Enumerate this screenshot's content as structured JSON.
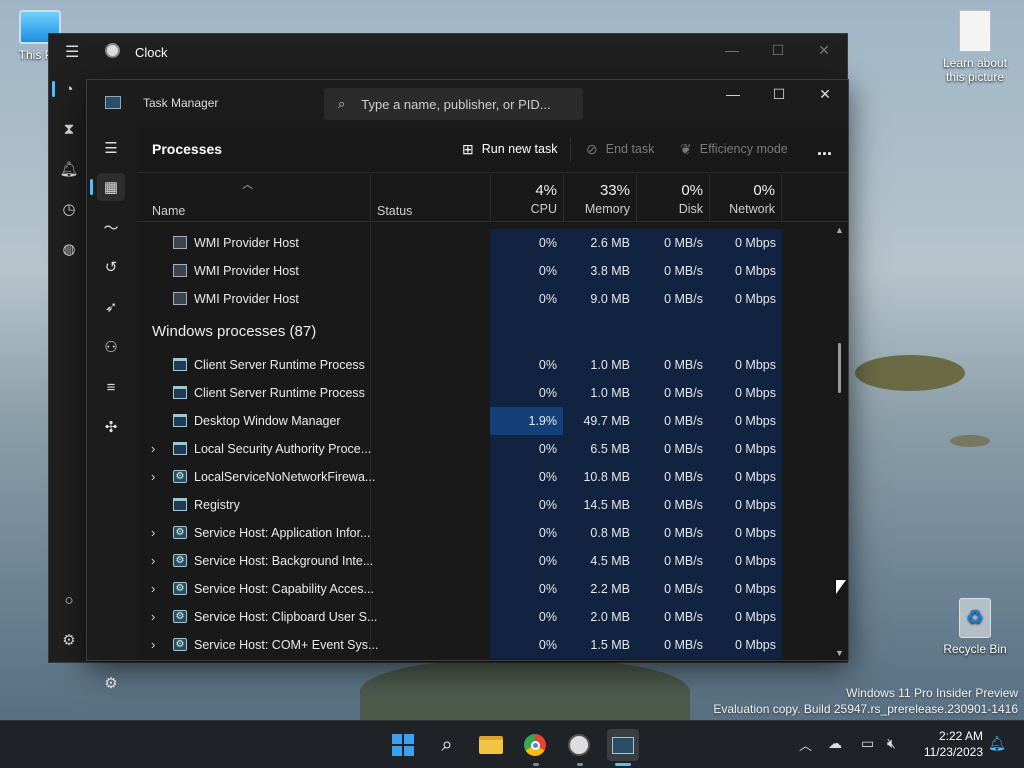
{
  "desktop": {
    "icons": [
      {
        "label": "This PC"
      },
      {
        "label": "Learn about this picture"
      },
      {
        "label": "Recycle Bin"
      }
    ],
    "watermark": {
      "line1": "Windows 11 Pro Insider Preview",
      "line2": "Evaluation copy. Build 25947.rs_prerelease.230901-1416"
    }
  },
  "clock_window": {
    "title": "Clock"
  },
  "task_manager": {
    "title": "Task Manager",
    "search_placeholder": "Type a name, publisher, or PID...",
    "page_title": "Processes",
    "toolbar": {
      "run_new_task": "Run new task",
      "end_task": "End task",
      "efficiency_mode": "Efficiency mode",
      "more": "..."
    },
    "columns": {
      "name": "Name",
      "status": "Status",
      "cpu": {
        "pct": "4%",
        "label": "CPU"
      },
      "memory": {
        "pct": "33%",
        "label": "Memory"
      },
      "disk": {
        "pct": "0%",
        "label": "Disk"
      },
      "network": {
        "pct": "0%",
        "label": "Network"
      }
    },
    "rows_top": [
      {
        "name": "WMI Provider Host",
        "cpu": "0%",
        "memory": "2.6 MB",
        "disk": "0 MB/s",
        "network": "0 Mbps"
      },
      {
        "name": "WMI Provider Host",
        "cpu": "0%",
        "memory": "3.8 MB",
        "disk": "0 MB/s",
        "network": "0 Mbps"
      },
      {
        "name": "WMI Provider Host",
        "cpu": "0%",
        "memory": "9.0 MB",
        "disk": "0 MB/s",
        "network": "0 Mbps"
      }
    ],
    "group_header": "Windows processes (87)",
    "rows_windows": [
      {
        "name": "Client Server Runtime Process",
        "cpu": "0%",
        "memory": "1.0 MB",
        "disk": "0 MB/s",
        "network": "0 Mbps",
        "expand": false,
        "icon": "window"
      },
      {
        "name": "Client Server Runtime Process",
        "cpu": "0%",
        "memory": "1.0 MB",
        "disk": "0 MB/s",
        "network": "0 Mbps",
        "expand": false,
        "icon": "window"
      },
      {
        "name": "Desktop Window Manager",
        "cpu": "1.9%",
        "memory": "49.7 MB",
        "disk": "0 MB/s",
        "network": "0 Mbps",
        "expand": false,
        "icon": "window"
      },
      {
        "name": "Local Security Authority Proce...",
        "cpu": "0%",
        "memory": "6.5 MB",
        "disk": "0 MB/s",
        "network": "0 Mbps",
        "expand": true,
        "icon": "window"
      },
      {
        "name": "LocalServiceNoNetworkFirewa...",
        "cpu": "0%",
        "memory": "10.8 MB",
        "disk": "0 MB/s",
        "network": "0 Mbps",
        "expand": true,
        "icon": "gear"
      },
      {
        "name": "Registry",
        "cpu": "0%",
        "memory": "14.5 MB",
        "disk": "0 MB/s",
        "network": "0 Mbps",
        "expand": false,
        "icon": "window"
      },
      {
        "name": "Service Host: Application Infor...",
        "cpu": "0%",
        "memory": "0.8 MB",
        "disk": "0 MB/s",
        "network": "0 Mbps",
        "expand": true,
        "icon": "gear"
      },
      {
        "name": "Service Host: Background Inte...",
        "cpu": "0%",
        "memory": "4.5 MB",
        "disk": "0 MB/s",
        "network": "0 Mbps",
        "expand": true,
        "icon": "gear"
      },
      {
        "name": "Service Host: Capability Acces...",
        "cpu": "0%",
        "memory": "2.2 MB",
        "disk": "0 MB/s",
        "network": "0 Mbps",
        "expand": true,
        "icon": "gear"
      },
      {
        "name": "Service Host: Clipboard User S...",
        "cpu": "0%",
        "memory": "2.0 MB",
        "disk": "0 MB/s",
        "network": "0 Mbps",
        "expand": true,
        "icon": "gear"
      },
      {
        "name": "Service Host: COM+ Event Sys...",
        "cpu": "0%",
        "memory": "1.5 MB",
        "disk": "0 MB/s",
        "network": "0 Mbps",
        "expand": true,
        "icon": "gear"
      }
    ]
  },
  "taskbar": {
    "time": "2:22 AM",
    "date": "11/23/2023",
    "apps": [
      "windows-start-icon",
      "search-icon",
      "file-explorer-icon",
      "chrome-icon",
      "clock-app-icon",
      "task-manager-icon"
    ]
  },
  "colors": {
    "accent": "#4cc2ff",
    "cpu_tint": "#112340",
    "cpu_hot": "#14407a"
  }
}
